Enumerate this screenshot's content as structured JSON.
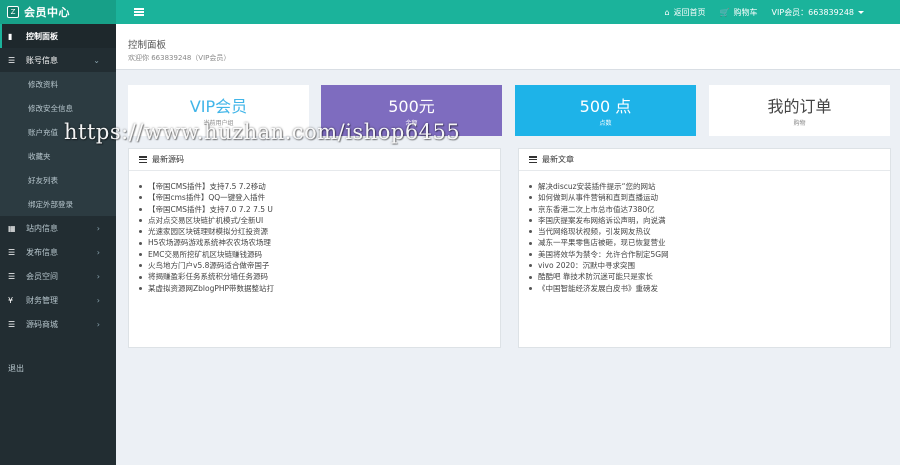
{
  "header": {
    "brand": "会员中心",
    "logo_char": "Z",
    "links": [
      {
        "icon": "home-icon",
        "glyph": "⌂",
        "label": "返回首页"
      },
      {
        "icon": "cart-icon",
        "glyph": "🛒",
        "label": "购物车"
      }
    ],
    "user_label": "VIP会员：663839248"
  },
  "sidebar": {
    "dashboard": "控制面板",
    "account": "账号信息",
    "account_sub": [
      "修改资料",
      "修改安全信息",
      "账户充值",
      "收藏夹",
      "好友列表",
      "绑定外部登录"
    ],
    "menus": [
      {
        "label": "站内信息",
        "glyph": "▦"
      },
      {
        "label": "发布信息",
        "glyph": "☰"
      },
      {
        "label": "会员空间",
        "glyph": "☰"
      },
      {
        "label": "财务管理",
        "glyph": "¥"
      },
      {
        "label": "源码商城",
        "glyph": "☰"
      }
    ],
    "logout": "退出"
  },
  "page": {
    "title": "控制面板",
    "subtitle": "欢迎你 663839248（VIP会员）"
  },
  "stats": [
    {
      "big": "VIP会员",
      "small": "当前用户组"
    },
    {
      "big": "500元",
      "small": "余额"
    },
    {
      "big": "500 点",
      "small": "点数"
    },
    {
      "big": "我的订单",
      "small": "购物"
    }
  ],
  "panels": {
    "source": {
      "title": "最新源码",
      "items": [
        "【帝国CMS插件】支持7.5 7.2移动",
        "【帝国cms插件】QQ一键登入插件",
        "【帝国CMS插件】支持7.0 7.2 7.5 U",
        "点对点交易区块链扩机模式/全新UI",
        "光速家园区块链理财模拟分红投资源",
        "H5农场源码游戏系统神农农场农场理",
        "EMC交易所挖矿机区块链赚钱源码",
        "火鸟地方门户v5.8源码适合做帝国子",
        "将揭赚盈彩任务系统积分墙任务源码",
        "某虚拟资源网ZblogPHP带数据整站打"
      ]
    },
    "articles": {
      "title": "最新文章",
      "items": [
        "解决discuz安装插件提示“您的网站",
        "如何做到从事件营销和直到直播运动",
        "京东香港二次上市总市值达7380亿",
        "李国庆提案发布网络诉讼声明，向说满",
        "当代网络现状视频，引发网友热议",
        "减东一平果零售店被砸，现已恢复营业",
        "美国将效华为禁令：允许合作制定5G网",
        "vivo 2020：沉默中寻求突围",
        "酷酷吧 靠技术防沉迷可能只是家长",
        "《中国智能经济发展白皮书》重磅发"
      ]
    }
  },
  "watermark": "https://www.huzhan.com/ishop6455"
}
